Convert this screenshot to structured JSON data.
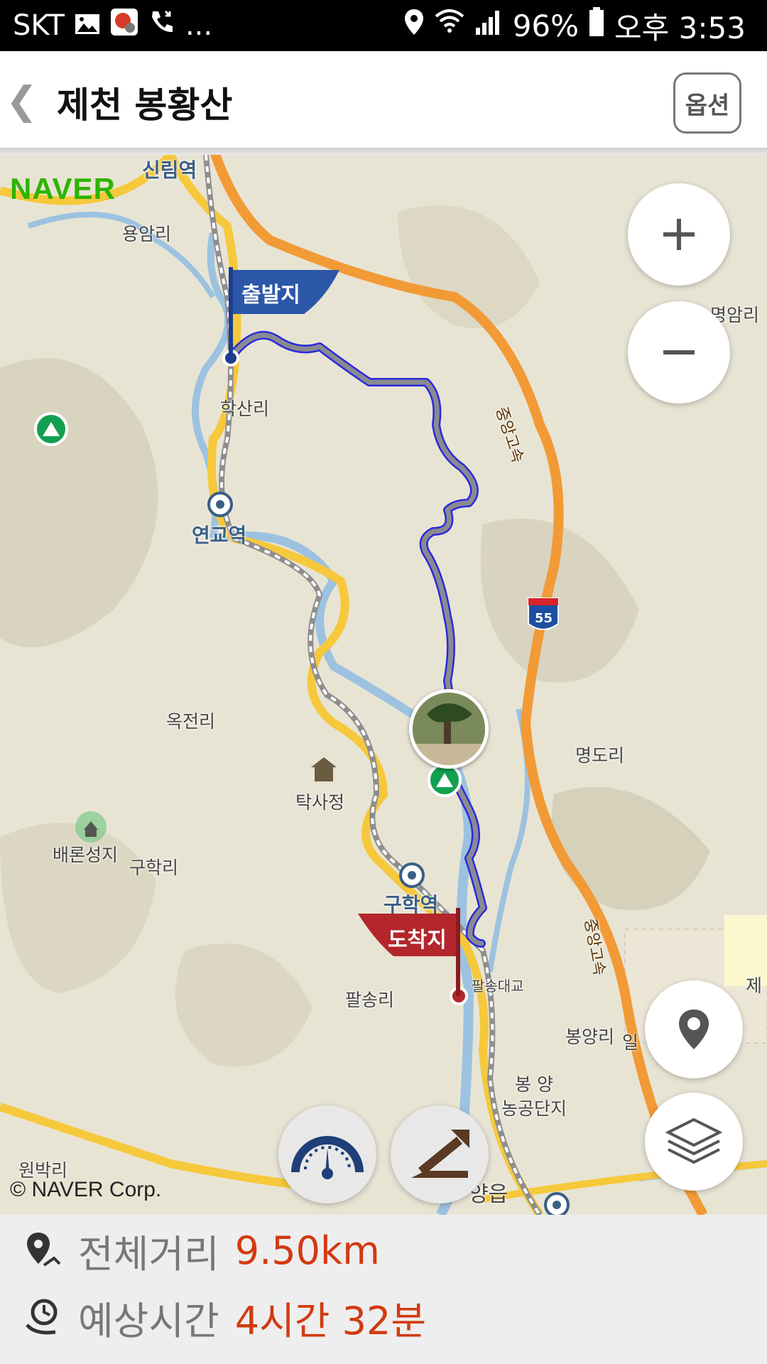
{
  "status_bar": {
    "carrier": "SKT",
    "ellipsis": "...",
    "battery": "96%",
    "time": "오후 3:53",
    "icons": [
      "image-icon",
      "app-notification-icon",
      "missed-call-icon",
      "location-icon",
      "wifi-icon",
      "signal-icon",
      "battery-icon"
    ]
  },
  "header": {
    "title": "제천 봉황산",
    "option_label": "옵션",
    "back_icon": "chevron-left-icon"
  },
  "map": {
    "provider_logo": "NAVER",
    "copyright": "© NAVER Corp.",
    "labels": {
      "sinrim_station": "신림역",
      "yongam": "용암리",
      "haksan": "학산리",
      "yeongyo_station": "연교역",
      "okjeon": "옥전리",
      "taksa": "탁사정",
      "baeron": "배론성지",
      "guhak": "구학리",
      "guhak_station": "구학역",
      "palsong": "팔송리",
      "bridge": "팔송대교",
      "myeongdo": "명도리",
      "myeongam": "명암리",
      "bongyang": "봉양리",
      "bongyang_complex": "봉 양\n농공단지",
      "wonbak": "원박리",
      "yangeup": "양읍",
      "highway": "중앙고속",
      "highway_number": "55",
      "il": "일",
      "je": "제"
    },
    "start_flag": "출발지",
    "end_flag": "도착지",
    "controls": [
      "zoom-in",
      "zoom-out",
      "my-location",
      "layers",
      "speedometer",
      "slope-profile"
    ]
  },
  "summary": {
    "distance_label": "전체거리",
    "distance_value": "9.50km",
    "time_label": "예상시간",
    "time_value": "4시간 32분"
  }
}
